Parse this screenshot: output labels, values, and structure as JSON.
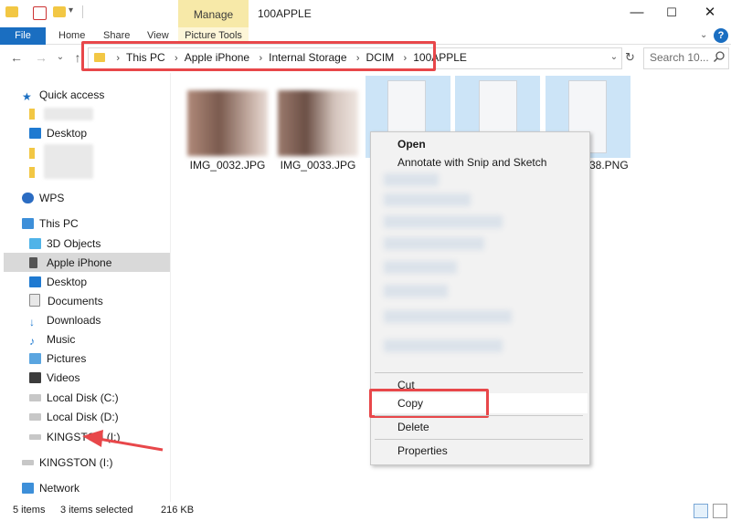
{
  "window": {
    "title": "100APPLE",
    "context_tab": "Manage",
    "context_tab_group": "Picture Tools",
    "controls": [
      "—",
      "☐",
      "✕"
    ]
  },
  "ribbon": {
    "file": "File",
    "tabs": [
      "Home",
      "Share",
      "View"
    ],
    "help": "?"
  },
  "address": {
    "crumbs": [
      "This PC",
      "Apple iPhone",
      "Internal Storage",
      "DCIM",
      "100APPLE"
    ],
    "search_placeholder": "Search 10..."
  },
  "nav": {
    "quick_access": "Quick access",
    "desktop_qa": "Desktop",
    "wps": "WPS",
    "this_pc": "This PC",
    "items": [
      "3D Objects",
      "Apple iPhone",
      "Desktop",
      "Documents",
      "Downloads",
      "Music",
      "Pictures",
      "Videos",
      "Local Disk (C:)",
      "Local Disk (D:)",
      "KINGSTON (I:)"
    ],
    "kingston": "KINGSTON (I:)",
    "network": "Network"
  },
  "files": {
    "items": [
      {
        "name": "IMG_0032.JPG"
      },
      {
        "name": "IMG_0033.JPG"
      },
      {
        "name": ""
      },
      {
        "name": ""
      },
      {
        "name": "38.PNG"
      }
    ]
  },
  "context_menu": {
    "open": "Open",
    "annotate": "Annotate with Snip and Sketch",
    "cut": "Cut",
    "copy": "Copy",
    "delete": "Delete",
    "properties": "Properties"
  },
  "status": {
    "count": "5 items",
    "selected": "3 items selected",
    "size": "216 KB"
  },
  "colors": {
    "accent": "#1a6ec1",
    "highlight": "#e8474a",
    "selection": "#cce4f7",
    "manage_tab": "#f7e9a8"
  }
}
